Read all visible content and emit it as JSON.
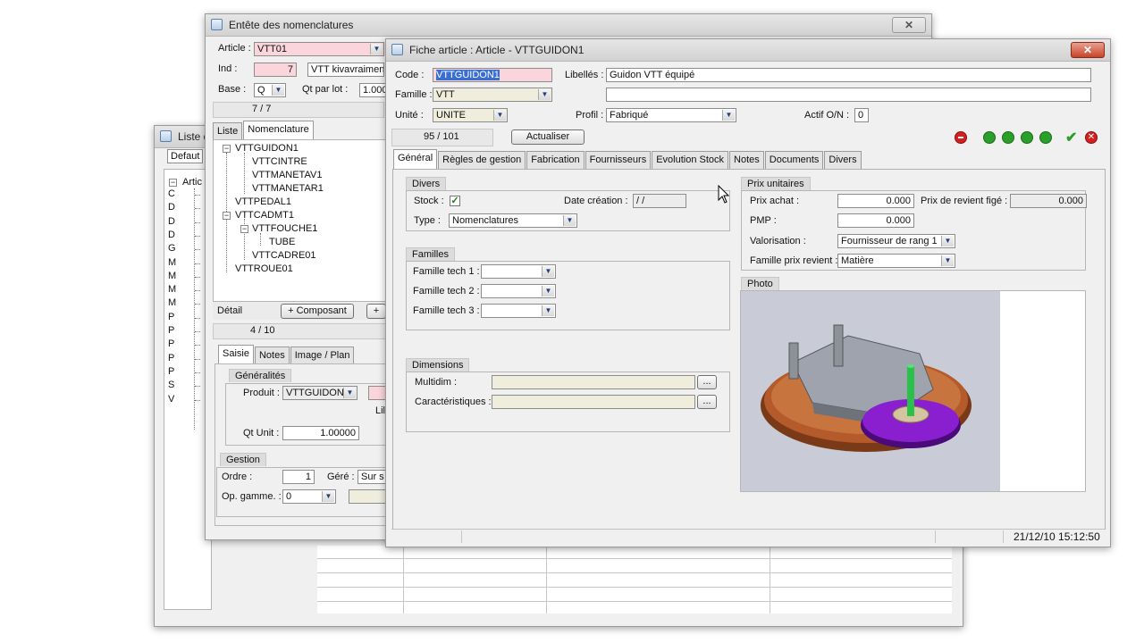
{
  "back_window": {
    "title": "Liste d",
    "filter_value": "Defaut",
    "tree_root": "Artic",
    "list_fragments": [
      "C",
      "D",
      "D",
      "D",
      "G",
      "M",
      "M",
      "M",
      "M",
      "P",
      "P",
      "P",
      "P",
      "P",
      "S",
      "V"
    ]
  },
  "nomenclature_window": {
    "title": "Entête des nomenclatures",
    "article_label": "Article :",
    "article_value": "VTT01",
    "ind_label": "Ind :",
    "ind_value": "7",
    "ind_desc": "VTT kivavraimen",
    "base_label": "Base :",
    "base_value": "Q",
    "qt_par_lot_label": "Qt par lot :",
    "qt_par_lot_value": "1.000",
    "counter": "7 / 7",
    "tabs": [
      "Liste",
      "Nomenclature"
    ],
    "tree": [
      "VTTGUIDON1",
      "VTTCINTRE",
      "VTTMANETAV1",
      "VTTMANETAR1",
      "VTTPEDAL1",
      "VTTCADMT1",
      "VTTFOUCHE1",
      "TUBE",
      "VTTCADRE01",
      "VTTROUE01"
    ],
    "detail_label": "Détail",
    "add_component": "+ Composant",
    "plus": "+",
    "detail_counter": "4 / 10",
    "sub_tabs": [
      "Saisie",
      "Notes",
      "Image / Plan"
    ],
    "generalites_label": "Généralités",
    "produit_label": "Produit :",
    "produit_value": "VTTGUIDON",
    "li_label": "Lil",
    "qt_unit_label": "Qt Unit :",
    "qt_unit_value": "1.00000",
    "gestion_label": "Gestion",
    "ordre_label": "Ordre :",
    "ordre_value": "1",
    "gere_label": "Géré :",
    "gere_value": "Sur s",
    "op_gamme_label": "Op. gamme. :",
    "op_gamme_value": "0"
  },
  "fiche_window": {
    "title": "Fiche article : Article - VTTGUIDON1",
    "close_glyph": "✕",
    "code_label": "Code :",
    "code_value": "VTTGUIDON1",
    "libelles_label": "Libellés :",
    "libelles_value": "Guidon VTT équipé",
    "libelles_value2": "",
    "famille_label": "Famille :",
    "famille_value": "VTT",
    "unite_label": "Unité :",
    "unite_value": "UNITE",
    "profil_label": "Profil :",
    "profil_value": "Fabriqué",
    "actif_label": "Actif O/N :",
    "actif_value": "0",
    "counter": "95 / 101",
    "actualiser": "Actualiser",
    "tabs": [
      "Général",
      "Règles de gestion",
      "Fabrication",
      "Fournisseurs",
      "Evolution Stock",
      "Notes",
      "Documents",
      "Divers"
    ],
    "divers": {
      "heading": "Divers",
      "stock_label": "Stock :",
      "stock_checked": true,
      "date_creation_label": "Date création :",
      "date_creation_value": "  /  /",
      "type_label": "Type :",
      "type_value": "Nomenclatures"
    },
    "familles": {
      "heading": "Familles",
      "tech1": "Famille tech 1 :",
      "tech2": "Famille tech 2 :",
      "tech3": "Famille tech 3 :"
    },
    "dimensions": {
      "heading": "Dimensions",
      "multidim": "Multidim :",
      "caracteristiques": "Caractéristiques :",
      "ellipsis": "..."
    },
    "prix": {
      "heading": "Prix unitaires",
      "prix_achat_label": "Prix achat :",
      "prix_achat_value": "0.000",
      "prix_revient_label": "Prix de revient figé :",
      "prix_revient_value": "0.000",
      "pmp_label": "PMP :",
      "pmp_value": "0.000",
      "valorisation_label": "Valorisation :",
      "valorisation_value": "Fournisseur de rang 1",
      "famille_prix_label": "Famille prix revient :",
      "famille_prix_value": "Matière"
    },
    "photo_heading": "Photo",
    "status_datetime": "21/12/10 15:12:50"
  },
  "colors": {
    "selection": "#3a6ecf",
    "pink_field": "#fbd5dc",
    "tan_field": "#efeedd",
    "nav_red": "#d42020",
    "nav_green": "#2aa02a"
  }
}
